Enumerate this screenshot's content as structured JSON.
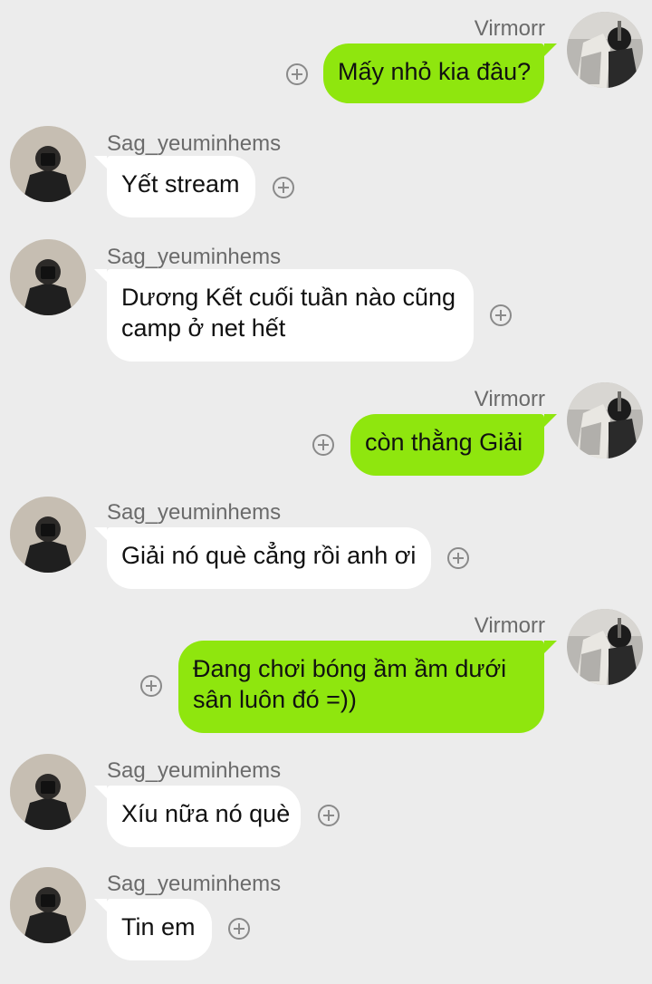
{
  "conversation": {
    "messages": [
      {
        "sender": "Virmorr",
        "direction": "out",
        "lines": [
          "Mấy nhỏ kia đâu?"
        ]
      },
      {
        "sender": "Sag_yeuminhems",
        "direction": "in",
        "lines": [
          "Yết stream"
        ]
      },
      {
        "sender": "Sag_yeuminhems",
        "direction": "in",
        "lines": [
          "Dương Kết cuối tuần nào cũng",
          "camp ở net hết"
        ]
      },
      {
        "sender": "Virmorr",
        "direction": "out",
        "lines": [
          "còn thằng Giải"
        ]
      },
      {
        "sender": "Sag_yeuminhems",
        "direction": "in",
        "lines": [
          "Giải nó què cẳng rồi anh ơi"
        ]
      },
      {
        "sender": "Virmorr",
        "direction": "out",
        "lines": [
          "Đang chơi bóng ầm ầm dưới",
          "sân luôn đó =))"
        ]
      },
      {
        "sender": "Sag_yeuminhems",
        "direction": "in",
        "lines": [
          "Xíu nữa nó què"
        ]
      },
      {
        "sender": "Sag_yeuminhems",
        "direction": "in",
        "lines": [
          "Tin em"
        ]
      }
    ]
  },
  "theme": {
    "background": "#ececec",
    "incoming_bubble": "#ffffff",
    "outgoing_bubble": "#8fe60e",
    "name_color": "#6b6b6b",
    "reaction_icon": "add-reaction-icon"
  }
}
